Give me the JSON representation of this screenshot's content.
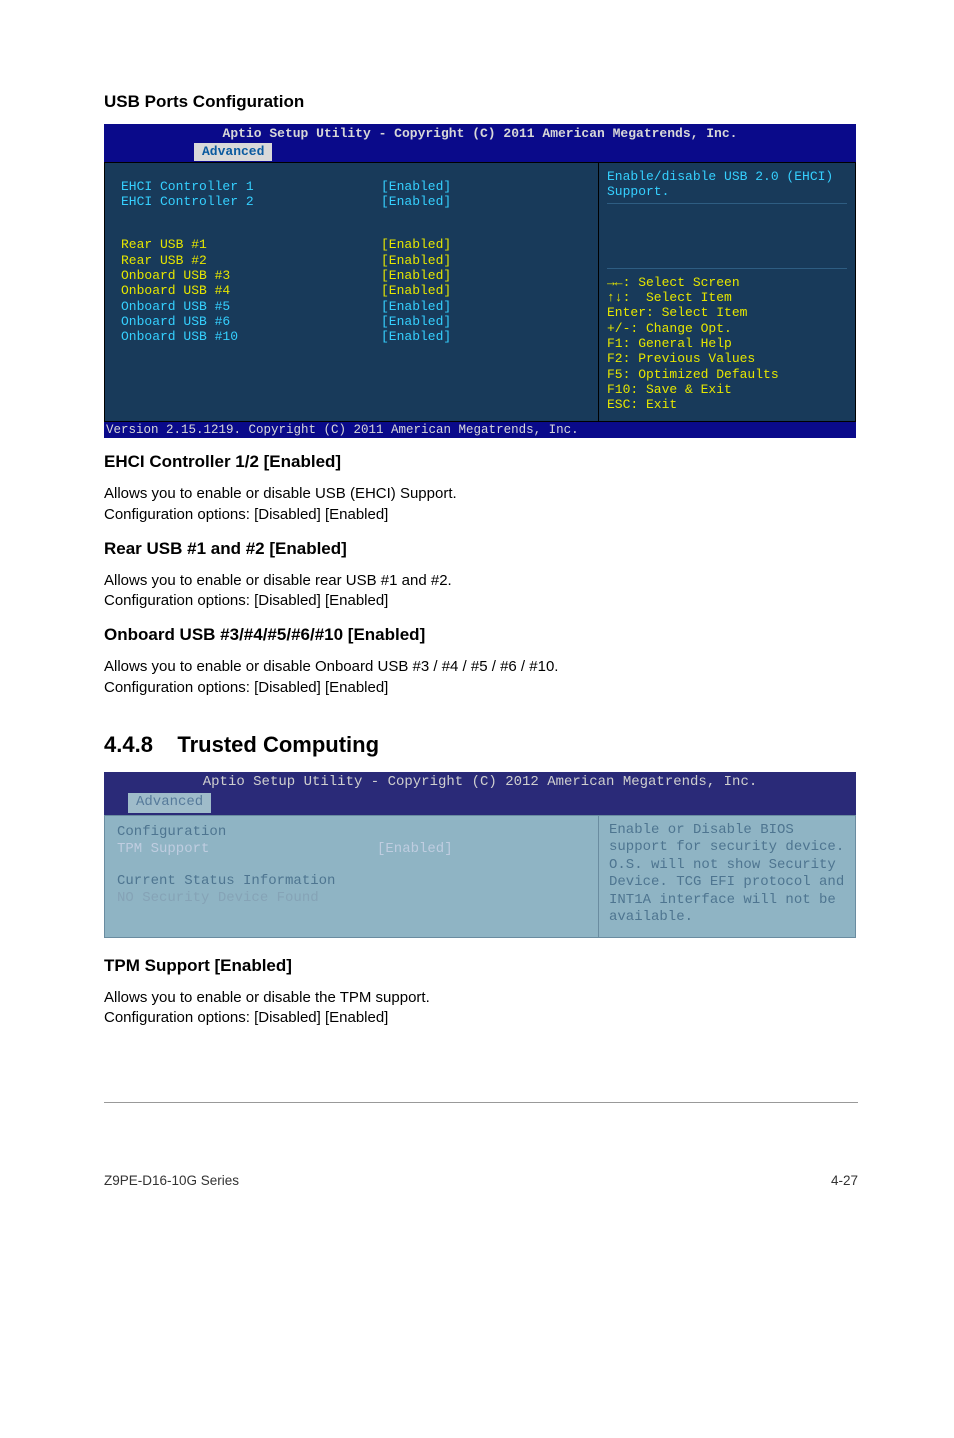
{
  "section_title_1": "USB Ports Configuration",
  "bios1": {
    "title": "Aptio Setup Utility - Copyright (C) 2011 American Megatrends, Inc.",
    "tab": "Advanced",
    "rows": [
      {
        "label": "EHCI Controller 1",
        "value": "[Enabled]",
        "color": "cyan"
      },
      {
        "label": "EHCI Controller 2",
        "value": "[Enabled]",
        "color": "cyan"
      }
    ],
    "rows2": [
      {
        "label": "Rear USB #1",
        "value": "[Enabled]"
      },
      {
        "label": "Rear USB #2",
        "value": "[Enabled]"
      },
      {
        "label": "Onboard USB #3",
        "value": "[Enabled]"
      },
      {
        "label": "Onboard USB #4",
        "value": "[Enabled]"
      },
      {
        "label": "Onboard USB #5",
        "value": "[Enabled]"
      },
      {
        "label": "Onboard USB #6",
        "value": "[Enabled]"
      },
      {
        "label": "Onboard USB #10",
        "value": "[Enabled]"
      }
    ],
    "help_top": "Enable/disable USB 2.0 (EHCI) Support.",
    "nav": "→←: Select Screen\n↑↓:  Select Item\nEnter: Select Item\n+/-: Change Opt.\nF1: General Help\nF2: Previous Values\nF5: Optimized Defaults\nF10: Save & Exit\nESC: Exit",
    "footer": "Version 2.15.1219. Copyright (C) 2011 American Megatrends, Inc."
  },
  "headings": {
    "ehci": "EHCI Controller 1/2 [Enabled]",
    "rear": "Rear USB #1 and #2 [Enabled]",
    "onboard": "Onboard USB #3/#4/#5/#6/#10 [Enabled]",
    "trusted_section": "4.4.8",
    "trusted_title": "Trusted Computing",
    "tpm": "TPM Support [Enabled]"
  },
  "body": {
    "ehci_1": "Allows you to enable or disable USB (EHCI) Support.",
    "ehci_2": "Configuration options: [Disabled] [Enabled]",
    "rear_1": "Allows you to enable or disable rear USB #1 and #2.",
    "rear_2": "Configuration options: [Disabled] [Enabled]",
    "onboard_1": "Allows you to enable or disable Onboard USB #3 / #4 / #5 / #6 / #10.",
    "onboard_2": "Configuration options: [Disabled] [Enabled]",
    "tpm_1": "Allows you to enable or disable the TPM support.",
    "tpm_2": "Configuration options: [Disabled] [Enabled]"
  },
  "bios2": {
    "title": "Aptio Setup Utility - Copyright (C) 2012 American Megatrends, Inc.",
    "tab": "Advanced",
    "left": {
      "l1": "Configuration",
      "l2_label": "  TPM Support",
      "l2_value": "[Enabled]",
      "l3": "Current Status Information",
      "l4": "  NO Security Device Found"
    },
    "right": "Enable or Disable BIOS support for security device. O.S. will not show Security Device. TCG EFI protocol and INT1A interface will not be available."
  },
  "footer": {
    "left": "Z9PE-D16-10G Series",
    "right": "4-27"
  }
}
